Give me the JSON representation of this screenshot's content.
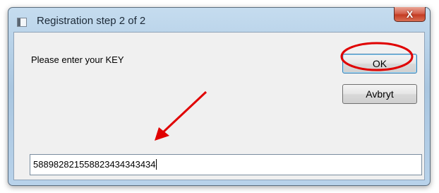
{
  "window": {
    "title": "Registration step 2 of 2",
    "close_label": "X"
  },
  "dialog": {
    "prompt": "Please enter your KEY",
    "ok_label": "OK",
    "cancel_label": "Avbryt",
    "key_value": "588982821558823434343434"
  },
  "annotations": {
    "color": "#e00000",
    "items": [
      "circle-around-ok-button",
      "arrow-pointing-to-key-field"
    ]
  }
}
